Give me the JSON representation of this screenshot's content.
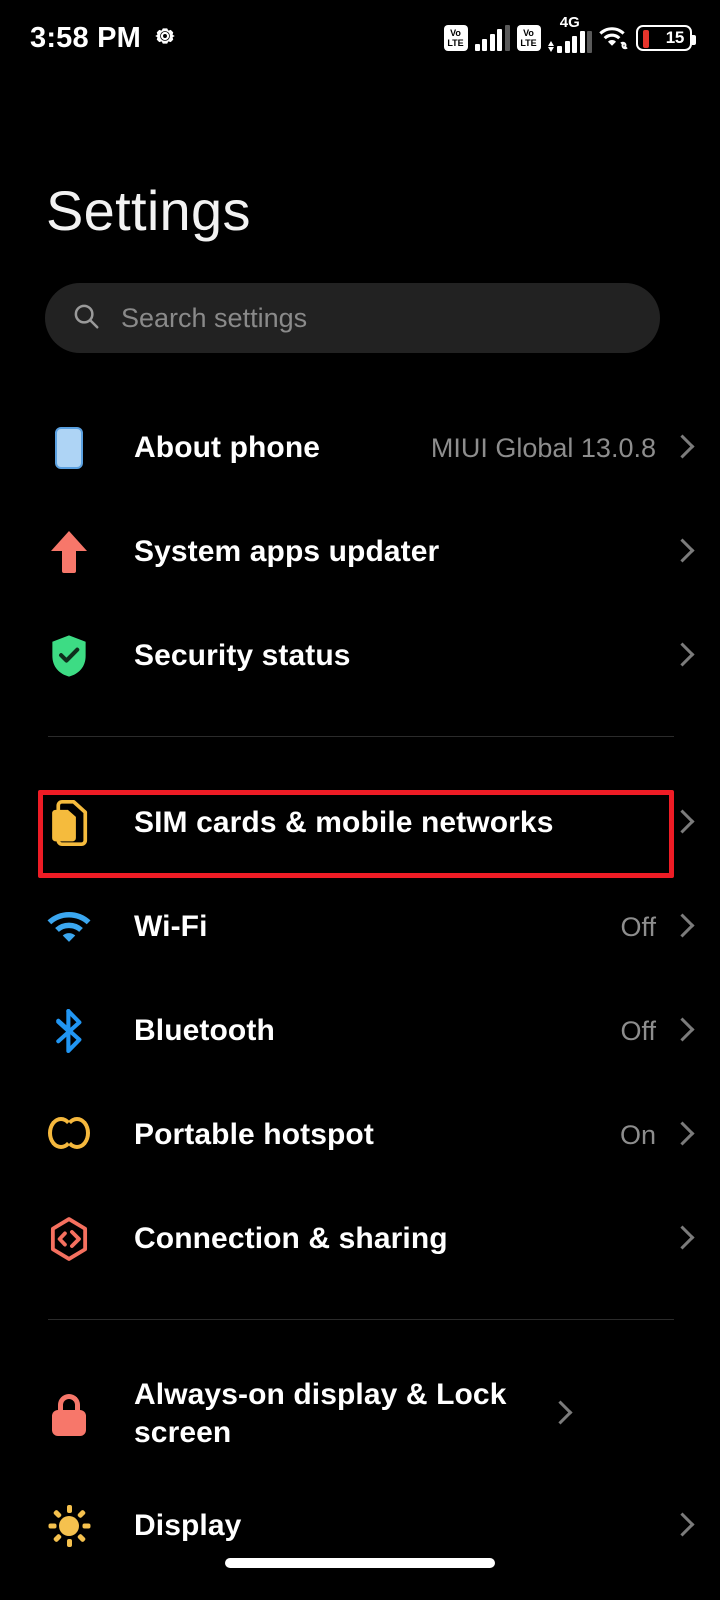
{
  "status_bar": {
    "time": "3:58 PM",
    "gear_icon": "gear-icon",
    "sim1_volte_top": "Vo",
    "sim1_volte_bottom": "LTE",
    "sim2_volte_top": "Vo",
    "sim2_volte_bottom": "LTE",
    "network_type": "4G",
    "wifi_icon": "wifi-linked-icon",
    "battery_percent": "15"
  },
  "header": {
    "title": "Settings"
  },
  "search": {
    "placeholder": "Search settings",
    "value": "",
    "icon": "search-icon"
  },
  "groups": [
    {
      "id": "device-group",
      "rows": [
        {
          "label": "About phone",
          "value": "MIUI Global 13.0.8",
          "icon": "phone-icon",
          "highlighted": false
        },
        {
          "label": "System apps updater",
          "value": "",
          "icon": "up-arrow-icon",
          "highlighted": false
        },
        {
          "label": "Security status",
          "value": "",
          "icon": "shield-check-icon",
          "highlighted": false
        }
      ]
    },
    {
      "id": "network-group",
      "rows": [
        {
          "label": "SIM cards & mobile networks",
          "value": "",
          "icon": "sim-card-icon",
          "highlighted": true
        },
        {
          "label": "Wi-Fi",
          "value": "Off",
          "icon": "wifi-icon",
          "highlighted": false
        },
        {
          "label": "Bluetooth",
          "value": "Off",
          "icon": "bluetooth-icon",
          "highlighted": false
        },
        {
          "label": "Portable hotspot",
          "value": "On",
          "icon": "hotspot-icon",
          "highlighted": false
        },
        {
          "label": "Connection & sharing",
          "value": "",
          "icon": "connection-sharing-icon",
          "highlighted": false
        }
      ]
    },
    {
      "id": "display-group",
      "rows": [
        {
          "label": "Always-on display & Lock screen",
          "value": "",
          "icon": "lock-icon",
          "highlighted": false
        },
        {
          "label": "Display",
          "value": "",
          "icon": "brightness-icon",
          "highlighted": false
        }
      ]
    }
  ],
  "colors": {
    "background": "#000000",
    "highlight_border": "#ee1c25",
    "search_bg": "#222222",
    "label": "#ffffff",
    "value": "#8d8d8d",
    "icon_phone": "#aed4f5",
    "icon_arrow": "#f7776a",
    "icon_shield": "#3ddc84",
    "icon_sim": "#f5bb3d",
    "icon_wifi": "#3ba7f0",
    "icon_bluetooth": "#2196f3",
    "icon_hotspot": "#f5b83d",
    "icon_connection": "#f5705f",
    "icon_lock": "#f7776a",
    "icon_sun": "#f5c14e"
  }
}
